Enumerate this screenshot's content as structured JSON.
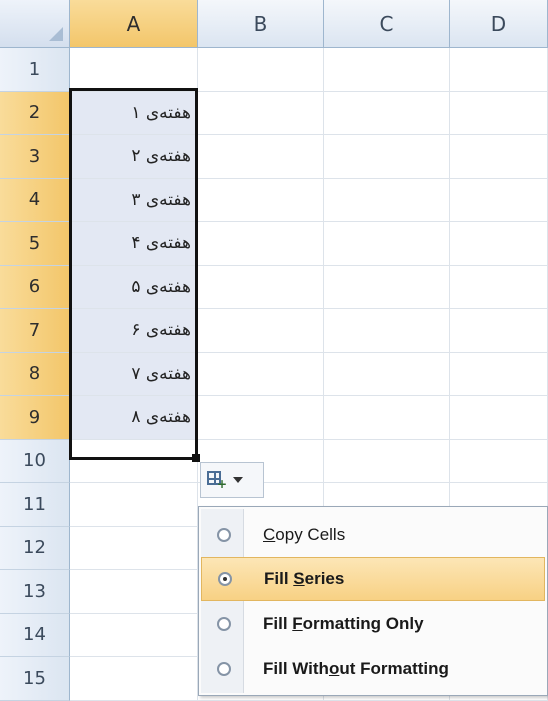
{
  "columns": [
    "A",
    "B",
    "C",
    "D"
  ],
  "rows": [
    "1",
    "2",
    "3",
    "4",
    "5",
    "6",
    "7",
    "8",
    "9",
    "10",
    "11",
    "12",
    "13",
    "14",
    "15"
  ],
  "cells": {
    "A2": "هفته‌ی ۱",
    "A3": "هفته‌ی ۲",
    "A4": "هفته‌ی ۳",
    "A5": "هفته‌ی ۴",
    "A6": "هفته‌ی ۵",
    "A7": "هفته‌ی ۶",
    "A8": "هفته‌ی ۷",
    "A9": "هفته‌ی ۸"
  },
  "selection": "A2:A9",
  "autofill_button": {
    "icon": "autofill-options-icon"
  },
  "autofill_menu": {
    "items": [
      {
        "label_pre": "",
        "label_key": "C",
        "label_post": "opy Cells",
        "checked": false,
        "highlighted": false
      },
      {
        "label_pre": "Fill ",
        "label_key": "S",
        "label_post": "eries",
        "checked": true,
        "highlighted": true
      },
      {
        "label_pre": "Fill ",
        "label_key": "F",
        "label_post": "ormatting Only",
        "checked": false,
        "highlighted": false
      },
      {
        "label_pre": "Fill With",
        "label_key": "o",
        "label_post": "ut Formatting",
        "checked": false,
        "highlighted": false
      }
    ]
  },
  "colors": {
    "selected_header": "#f3c66a",
    "filled_cell": "#e3e8f3",
    "menu_highlight": "#f8d184"
  }
}
